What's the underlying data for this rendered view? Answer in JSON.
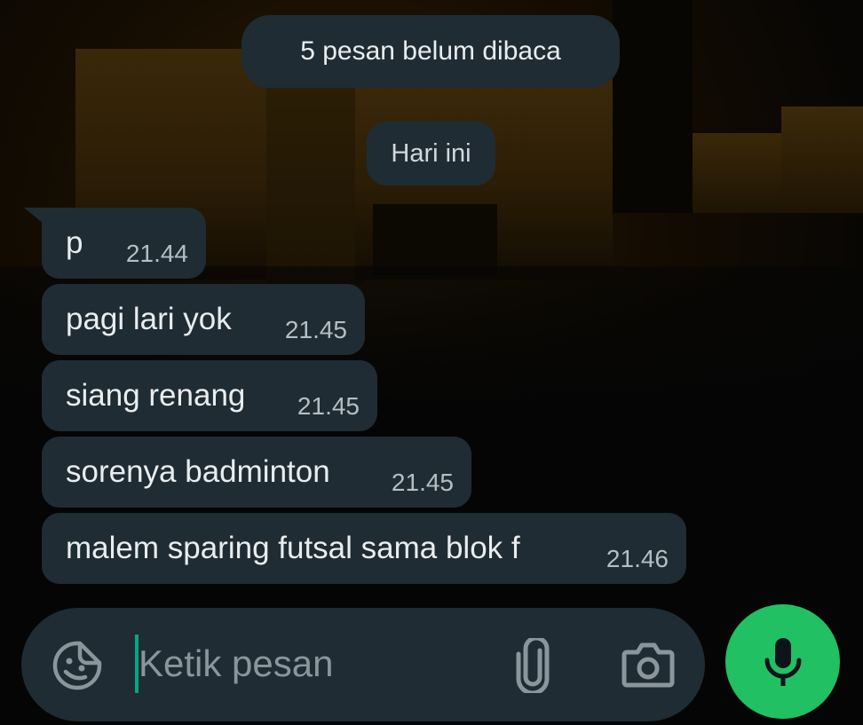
{
  "chat": {
    "unread_banner": "5 pesan belum dibaca",
    "date_divider": "Hari ini",
    "messages": [
      {
        "text": "p",
        "time": "21.44"
      },
      {
        "text": "pagi lari yok",
        "time": "21.45"
      },
      {
        "text": "siang renang",
        "time": "21.45"
      },
      {
        "text": "sorenya badminton",
        "time": "21.45"
      },
      {
        "text": "malem sparing futsal sama blok f",
        "time": "21.46"
      }
    ]
  },
  "composer": {
    "placeholder": "Ketik pesan",
    "icons": {
      "sticker": "sticker-icon",
      "attach": "paperclip-icon",
      "camera": "camera-icon",
      "mic": "microphone-icon"
    }
  },
  "colors": {
    "bubble": "#1f2c33",
    "accent_green": "#21c063",
    "caret": "#00a884",
    "text": "#e9edef",
    "timestamp": "#b5bec3"
  }
}
